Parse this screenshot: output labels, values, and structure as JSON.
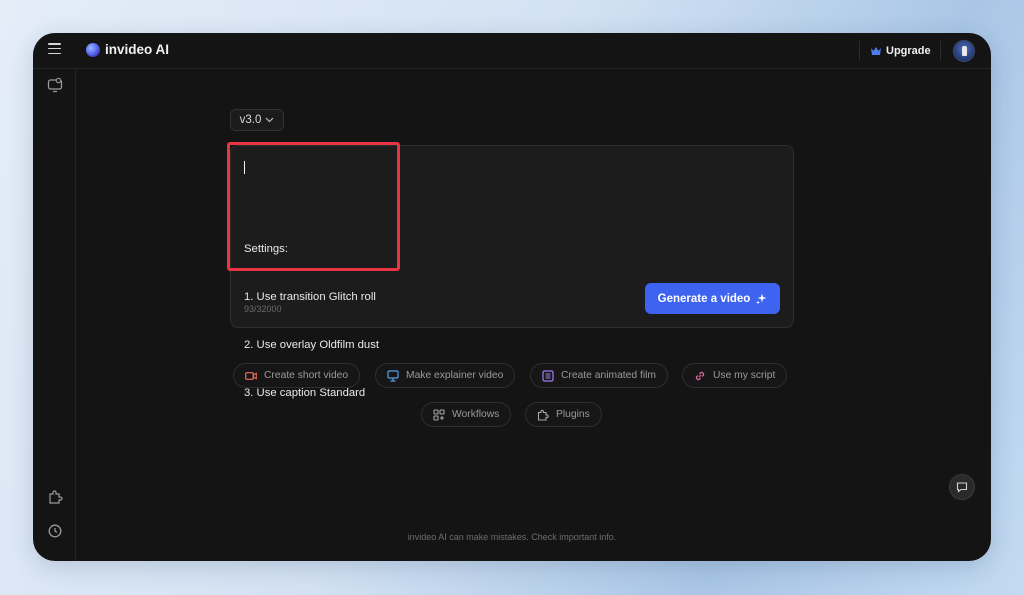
{
  "app": {
    "title": "invideo AI"
  },
  "header": {
    "upgrade_label": "Upgrade"
  },
  "version": {
    "selected": "v3.0"
  },
  "prompt": {
    "lines": [
      "Settings:",
      "1. Use transition Glitch roll",
      "2. Use overlay Oldfilm dust",
      "3. Use caption Standard"
    ],
    "char_count": "93/32000"
  },
  "generate_label": "Generate a video",
  "chips_row1": [
    {
      "label": "Create short video",
      "icon": "video-camera-icon",
      "color": "#e9735a"
    },
    {
      "label": "Make explainer video",
      "icon": "presentation-icon",
      "color": "#5a9de9"
    },
    {
      "label": "Create animated film",
      "icon": "film-list-icon",
      "color": "#9b7ff0"
    },
    {
      "label": "Use my script",
      "icon": "link-icon",
      "color": "#e96aa8"
    }
  ],
  "chips_row2": [
    {
      "label": "Workflows",
      "icon": "grid-icon",
      "color": "#a8a8a8"
    },
    {
      "label": "Plugins",
      "icon": "puzzle-icon",
      "color": "#a8a8a8"
    }
  ],
  "disclaimer": "invideo AI can make mistakes. Check important info.",
  "colors": {
    "accent": "#3e63f1",
    "highlight": "#ea3343",
    "background": "#141414"
  }
}
